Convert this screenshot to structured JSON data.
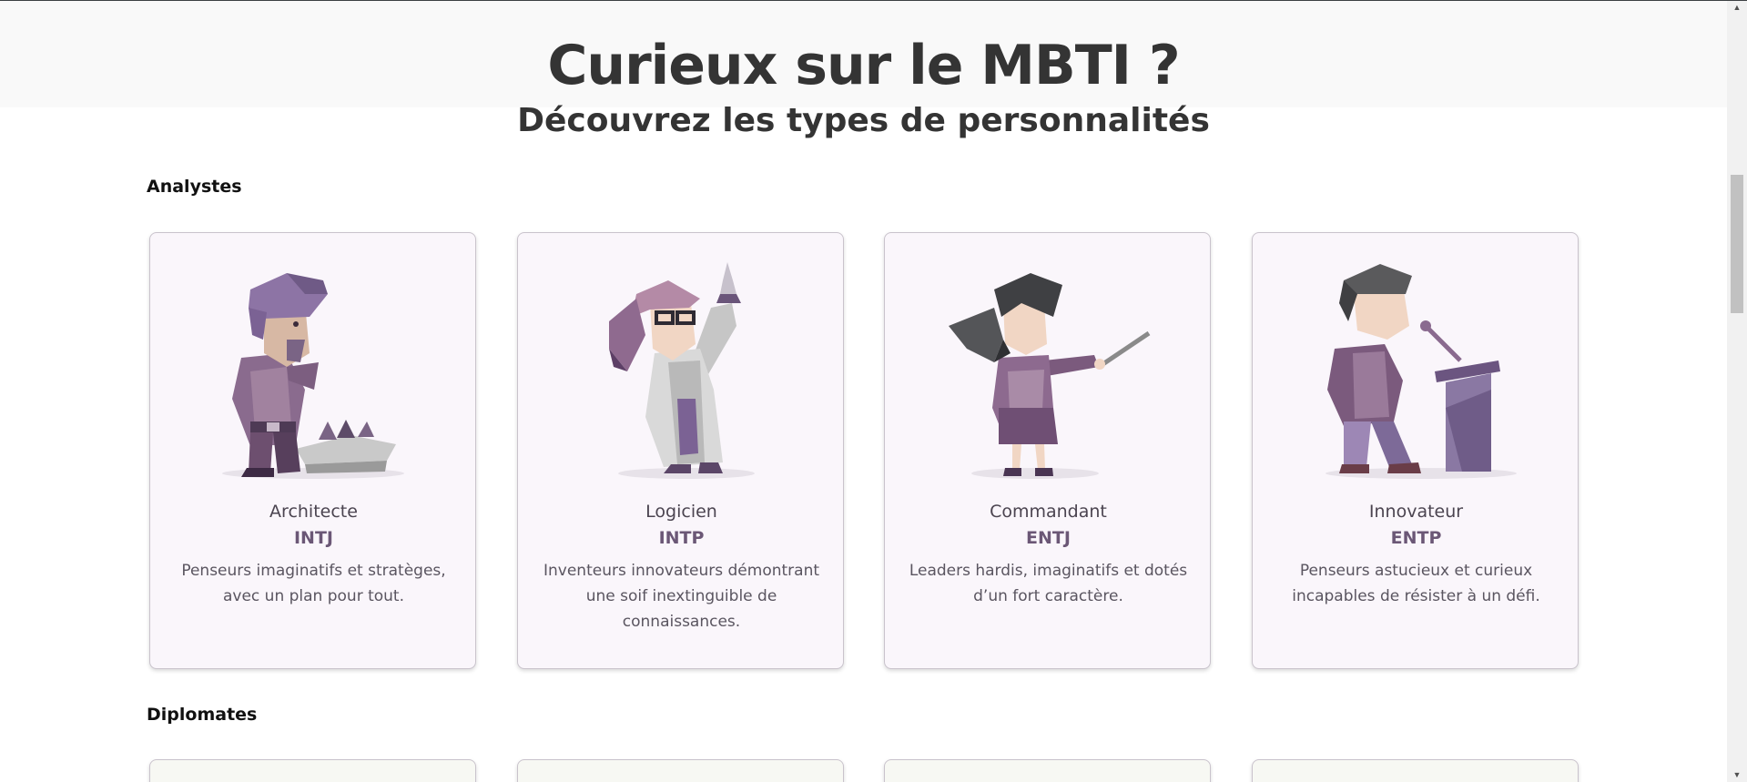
{
  "header": {
    "title": "Curieux sur le MBTI ?",
    "subtitle": "Découvrez les types de personnalités"
  },
  "sections": [
    {
      "title": "Analystes",
      "cards": [
        {
          "name": "Architecte",
          "code": "INTJ",
          "description": "Penseurs imaginatifs et stratèges, avec un plan pour tout.",
          "illustration": "architect-figure"
        },
        {
          "name": "Logicien",
          "code": "INTP",
          "description": "Inventeurs innovateurs démontrant une soif inextinguible de connaissances.",
          "illustration": "logician-figure"
        },
        {
          "name": "Commandant",
          "code": "ENTJ",
          "description": "Leaders hardis, imaginatifs et dotés d’un fort caractère.",
          "illustration": "commander-figure"
        },
        {
          "name": "Innovateur",
          "code": "ENTP",
          "description": "Penseurs astucieux et curieux incapables de résister à un défi.",
          "illustration": "debater-figure"
        }
      ]
    },
    {
      "title": "Diplomates",
      "cards": []
    }
  ],
  "colors": {
    "analyst_card_bg": "#faf6fb",
    "diplomat_card_bg": "#f7f8f3",
    "accent": "#6b5776",
    "title": "#343434"
  }
}
